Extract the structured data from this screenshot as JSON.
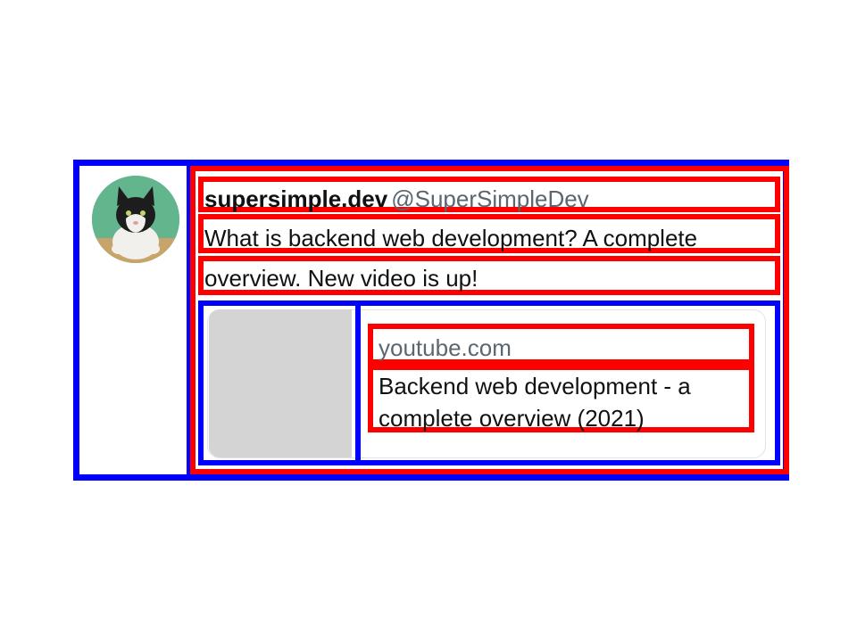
{
  "tweet": {
    "author_name": "supersimple.dev",
    "author_handle": "@SuperSimpleDev",
    "text_line_1": "What is backend web development? A complete",
    "text_line_2": "overview. New video is up!",
    "link_card": {
      "domain": "youtube.com",
      "title": "Backend web development - a complete overview (2021)"
    }
  },
  "colors": {
    "annotation_blue": "#0000ff",
    "annotation_red": "#ff0000",
    "handle_gray": "#5b6670",
    "thumbnail_gray": "#d4d4d4",
    "avatar_background": "#63b58e"
  }
}
